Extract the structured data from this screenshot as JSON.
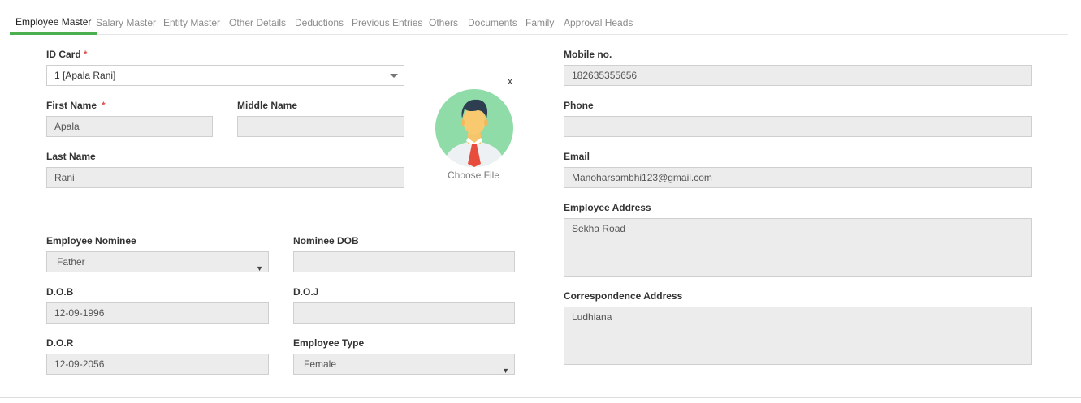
{
  "tabs": [
    {
      "label": "Employee Master"
    },
    {
      "label": "Salary Master"
    },
    {
      "label": "Entity Master"
    },
    {
      "label": "Other Details"
    },
    {
      "label": "Deductions"
    },
    {
      "label": "Previous Entries"
    },
    {
      "label": "Others"
    },
    {
      "label": "Documents"
    },
    {
      "label": "Family"
    },
    {
      "label": "Approval Heads"
    }
  ],
  "form": {
    "id_card": {
      "label": "ID Card",
      "required_mark": "*",
      "value": "1 [Apala Rani]"
    },
    "first_name": {
      "label": "First Name",
      "required_mark": "*",
      "value": "Apala"
    },
    "middle_name": {
      "label": "Middle Name",
      "value": ""
    },
    "last_name": {
      "label": "Last Name",
      "value": "Rani"
    },
    "photo": {
      "close": "x",
      "choose_file": "Choose File"
    },
    "employee_nominee": {
      "label": "Employee Nominee",
      "value": "Father"
    },
    "nominee_dob": {
      "label": "Nominee DOB",
      "value": ""
    },
    "dob": {
      "label": "D.O.B",
      "value": "12-09-1996"
    },
    "doj": {
      "label": "D.O.J",
      "value": ""
    },
    "dor": {
      "label": "D.O.R",
      "value": "12-09-2056"
    },
    "employee_type": {
      "label": "Employee Type",
      "value": "Female"
    },
    "mobile": {
      "label": "Mobile no.",
      "value": "182635355656"
    },
    "phone": {
      "label": "Phone",
      "value": ""
    },
    "email": {
      "label": "Email",
      "value": "Manoharsambhi123@gmail.com"
    },
    "employee_address": {
      "label": "Employee Address",
      "value": "Sekha Road"
    },
    "correspondence_address": {
      "label": "Correspondence Address",
      "value": "Ludhiana"
    }
  },
  "colors": {
    "accent": "#4caf50",
    "required": "#d9534f",
    "avatar_bg": "#8fdca8",
    "tie": "#e74c3c"
  },
  "icons": {
    "dropdown": "caret-down-icon",
    "select": "triangle-down-icon",
    "close": "close-icon",
    "avatar": "user-avatar-icon"
  }
}
